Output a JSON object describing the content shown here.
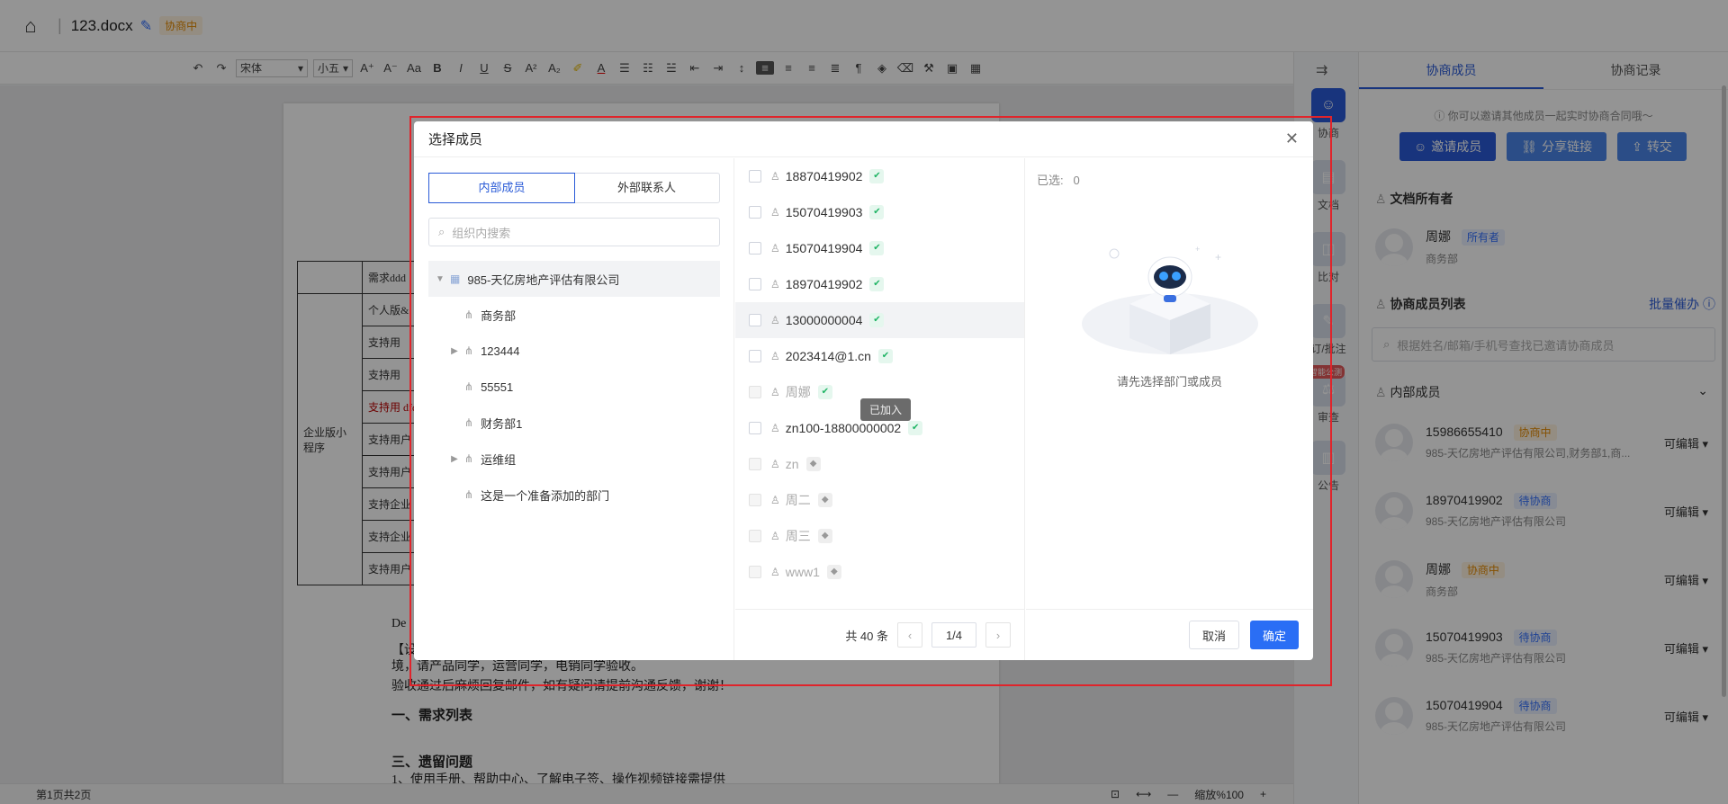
{
  "header": {
    "doc_name": "123.docx",
    "status": "协商中"
  },
  "toolbar": {
    "font": "宋体",
    "size": "小五"
  },
  "document": {
    "table_rows": [
      [
        "",
        "需求ddd"
      ],
      [
        "企业版小程序",
        "个人版&"
      ],
      [
        "",
        "支持用"
      ],
      [
        "",
        "支持用"
      ],
      [
        "",
        "支持用 dfdafdla"
      ],
      [
        "",
        "支持用户"
      ],
      [
        "",
        "支持用户"
      ],
      [
        "",
        "支持企业"
      ],
      [
        "",
        "支持企业"
      ],
      [
        "",
        "支持用户"
      ]
    ],
    "line1": "De",
    "para": "【设者愚意设置企业&个人初始企微绑定】迭代已在SIT环境测试通过，已部署到UAT环境，请产品同学，运营同学，电销同学验收。",
    "para2": "验收通过后麻烦回复邮件，如有疑问请提前沟通反馈，谢谢！",
    "h1": "一、需求列表",
    "h2": "三、遗留问题",
    "bottom": "1、使用手册、帮助中心、了解电子签、操作视频链接需提供"
  },
  "statusbar": {
    "pages": "第1页共2页",
    "zoom": "缩放%100"
  },
  "iconcol": [
    {
      "label": "协商"
    },
    {
      "label": "文档"
    },
    {
      "label": "比对"
    },
    {
      "label": "订/批注"
    },
    {
      "label": "审查",
      "badge": "智能公测"
    },
    {
      "label": "公告"
    }
  ],
  "panel": {
    "tabs": [
      "协商成员",
      "协商记录"
    ],
    "tip": "你可以邀请其他成员一起实时协商合同哦～",
    "buttons": [
      "邀请成员",
      "分享链接",
      "转交"
    ],
    "owner_title": "文档所有者",
    "owner": {
      "name": "周娜",
      "tag": "所有者",
      "dept": "商务部"
    },
    "list_title": "协商成员列表",
    "batch": "批量催办",
    "search_placeholder": "根据姓名/邮箱/手机号查找已邀请协商成员",
    "group": "内部成员",
    "members": [
      {
        "name": "15986655410",
        "tag": "协商中",
        "tagtype": "orange",
        "dept": "985-天亿房地产评估有限公司,财务部1,商...",
        "perm": "可编辑"
      },
      {
        "name": "18970419902",
        "tag": "待协商",
        "tagtype": "blue",
        "dept": "985-天亿房地产评估有限公司",
        "perm": "可编辑"
      },
      {
        "name": "周娜",
        "tag": "协商中",
        "tagtype": "orange",
        "dept": "商务部",
        "perm": "可编辑"
      },
      {
        "name": "15070419903",
        "tag": "待协商",
        "tagtype": "blue",
        "dept": "985-天亿房地产评估有限公司",
        "perm": "可编辑"
      },
      {
        "name": "15070419904",
        "tag": "待协商",
        "tagtype": "blue",
        "dept": "985-天亿房地产评估有限公司",
        "perm": "可编辑"
      }
    ]
  },
  "modal": {
    "title": "选择成员",
    "tabs": [
      "内部成员",
      "外部联系人"
    ],
    "search_placeholder": "组织内搜索",
    "tree": [
      {
        "label": "985-天亿房地产评估有限公司",
        "root": true,
        "expand": true
      },
      {
        "label": "商务部",
        "caret": false
      },
      {
        "label": "123444",
        "caret": true
      },
      {
        "label": "55551",
        "caret": false
      },
      {
        "label": "财务部1",
        "caret": false
      },
      {
        "label": "运维组",
        "caret": true
      },
      {
        "label": "这是一个准备添加的部门",
        "caret": false
      }
    ],
    "members": [
      {
        "name": "18870419902",
        "disabled": false,
        "verified": true
      },
      {
        "name": "15070419903",
        "disabled": false,
        "verified": true
      },
      {
        "name": "15070419904",
        "disabled": false,
        "verified": true
      },
      {
        "name": "18970419902",
        "disabled": false,
        "verified": true
      },
      {
        "name": "13000000004",
        "disabled": false,
        "verified": true
      },
      {
        "name": "2023414@1.cn",
        "disabled": false,
        "verified": true
      },
      {
        "name": "周娜",
        "disabled": true,
        "verified": true
      },
      {
        "name": "zn100-18800000002",
        "disabled": false,
        "verified": true
      },
      {
        "name": "zn",
        "disabled": true,
        "verified": false
      },
      {
        "name": "周二",
        "disabled": true,
        "verified": false
      },
      {
        "name": "周三",
        "disabled": true,
        "verified": false
      },
      {
        "name": "www1",
        "disabled": true,
        "verified": false
      }
    ],
    "tooltip": "已加入",
    "total": "共 40 条",
    "page": "1/4",
    "selected_label": "已选:",
    "selected_count": "0",
    "empty": "请先选择部门或成员",
    "cancel": "取消",
    "ok": "确定"
  }
}
